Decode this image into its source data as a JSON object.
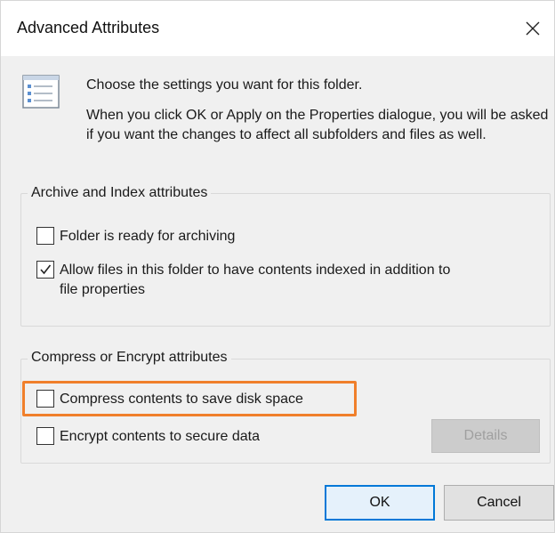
{
  "window": {
    "title": "Advanced Attributes",
    "close_glyph": "✕"
  },
  "header": {
    "intro": "Choose the settings you want for this folder.",
    "description": "When you click OK or Apply on the Properties dialogue, you will be asked if you want the changes to affect all subfolders and files as well."
  },
  "archive_group": {
    "label": "Archive and Index attributes",
    "archiving": {
      "label": "Folder is ready for archiving",
      "checked": false
    },
    "indexing": {
      "label_line1": "Allow files in this folder to have contents indexed in addition to",
      "label_line2": "file properties",
      "checked": true
    }
  },
  "compress_group": {
    "label": "Compress or Encrypt attributes",
    "compress": {
      "label": "Compress contents to save disk space",
      "checked": false
    },
    "encrypt": {
      "label": "Encrypt contents to secure data",
      "checked": false
    },
    "details_label": "Details"
  },
  "footer": {
    "ok_label": "OK",
    "cancel_label": "Cancel"
  },
  "colors": {
    "highlight": "#f07f2b",
    "ok_border": "#0078d7"
  },
  "icons": [
    "close-icon",
    "folder-settings-icon",
    "checkmark-icon"
  ]
}
